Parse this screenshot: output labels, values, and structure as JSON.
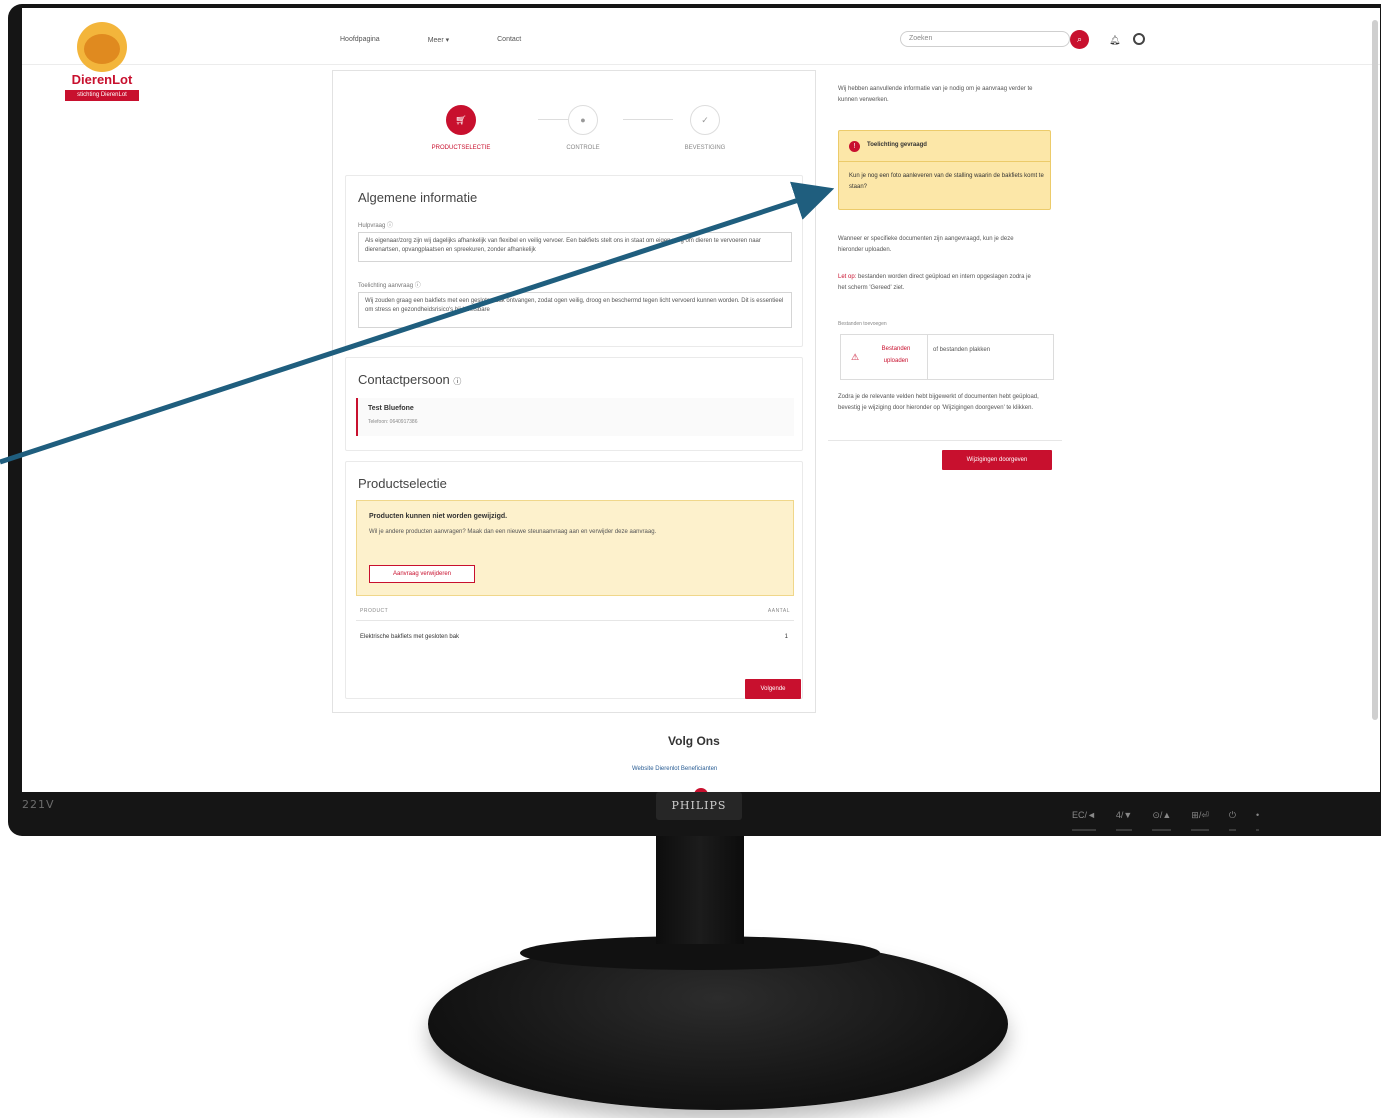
{
  "monitor": {
    "model": "221V",
    "brand": "PHILIPS",
    "buttons": [
      "EC/◄",
      "4/▼",
      "⊙/▲",
      "⊞/⏎",
      "⏻",
      "•"
    ]
  },
  "site": {
    "logo_text": "DierenLot",
    "logo_band": "stichting DierenLot",
    "nav": [
      "Hoofdpagina",
      "Meer ▾",
      "Contact"
    ],
    "search_placeholder": "Zoeken"
  },
  "stepper": {
    "steps": [
      {
        "label": "PRODUCTSELECTIE",
        "icon": "cart-icon",
        "active": true
      },
      {
        "label": "CONTROLE",
        "icon": "eye-icon",
        "active": false
      },
      {
        "label": "BEVESTIGING",
        "icon": "check-icon",
        "active": false
      }
    ]
  },
  "general_info": {
    "title": "Algemene informatie",
    "field1_label": "Hulpvraag",
    "field1_text": "Als eigenaar/zorg zijn wij dagelijks afhankelijk van flexibel en veilig vervoer. Een bakfiets stelt ons in staat om eigen zorg om dieren te vervoeren naar dierenartsen, opvangplaatsen en spreekuren, zonder afhankelijk",
    "field2_label": "Toelichting aanvraag",
    "field2_text": "Wij zouden graag een bakfiets met een gesloten bak ontvangen, zodat ogen veilig, droog en beschermd tegen licht vervoerd kunnen worden. Dit is essentieel om stress en gezondheidsrisico's bij kwetsbare"
  },
  "contact": {
    "title": "Contactpersoon",
    "name": "Test Bluefone",
    "phone": "Telefoon: 0640917386"
  },
  "products": {
    "title": "Productselectie",
    "warning_title": "Producten kunnen niet worden gewijzigd.",
    "warning_text": "Wil je andere producten aanvragen? Maak dan een nieuwe steunaanvraag aan en verwijder deze aanvraag.",
    "remove_button": "Aanvraag verwijderen",
    "col_product": "PRODUCT",
    "col_amount": "AANTAL",
    "rows": [
      {
        "product": "Elektrische bakfiets met gesloten bak",
        "amount": "1"
      }
    ],
    "next_button": "Volgende"
  },
  "sidebar": {
    "intro": "Wij hebben aanvullende informatie van je nodig om je aanvraag verder te kunnen verwerken.",
    "notice_title": "Toelichting gevraagd",
    "notice_text": "Kun je nog een foto aanleveren van de stalling waarin de bakfiets komt te staan?",
    "docs_text": "Wanneer er specifieke documenten zijn aangevraagd, kun je deze hieronder uploaden.",
    "tip_label": "Let op:",
    "tip_text": "bestanden worden direct geüpload en intern opgeslagen zodra je het scherm 'Gereed' ziet.",
    "upload_label": "Bestanden toevoegen",
    "upload_button": "Bestanden uploaden",
    "upload_or": "of bestanden plakken",
    "finish_text": "Zodra je de relevante velden hebt bijgewerkt of documenten hebt geüpload, bevestig je wijziging door hieronder op 'Wijzigingen doorgeven' te klikken.",
    "submit_button": "Wijzigingen doorgeven"
  },
  "footer": {
    "title": "Volg Ons",
    "links": "Website Dierenlot   Beneficianten"
  },
  "colors": {
    "brand": "#c8102e",
    "arrow": "#1f5e7e",
    "notice_bg": "#fce7a8"
  }
}
